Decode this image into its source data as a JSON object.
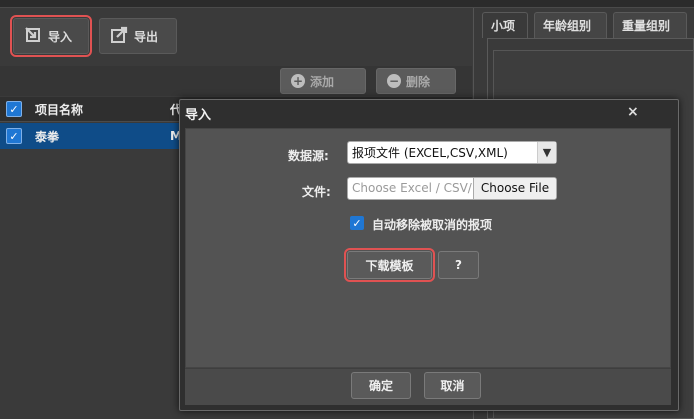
{
  "toolbar": {
    "import_label": "导入",
    "export_label": "导出",
    "add_label": "添加",
    "delete_label": "删除"
  },
  "grid": {
    "headers": [
      "项目名称",
      "代"
    ],
    "rows": [
      {
        "name": "泰拳",
        "code": "M",
        "checked": true
      }
    ]
  },
  "tabs": [
    {
      "label": "小项",
      "active": true
    },
    {
      "label": "年龄组别",
      "active": false
    },
    {
      "label": "重量组别",
      "active": false
    }
  ],
  "dialog": {
    "title": "导入",
    "close": "×",
    "datasource_label": "数据源:",
    "datasource_value": "报项文件 (EXCEL,CSV,XML)",
    "file_label": "文件:",
    "file_placeholder": "Choose Excel / CSV/",
    "choose_file_label": "Choose File",
    "auto_remove_label": "自动移除被取消的报项",
    "auto_remove_checked": true,
    "download_template_label": "下载模板",
    "help_label": "?",
    "ok_label": "确定",
    "cancel_label": "取消"
  },
  "colors": {
    "highlight": "#e05252",
    "selected_row": "#0f4c88",
    "checkbox": "#1f77d4"
  }
}
